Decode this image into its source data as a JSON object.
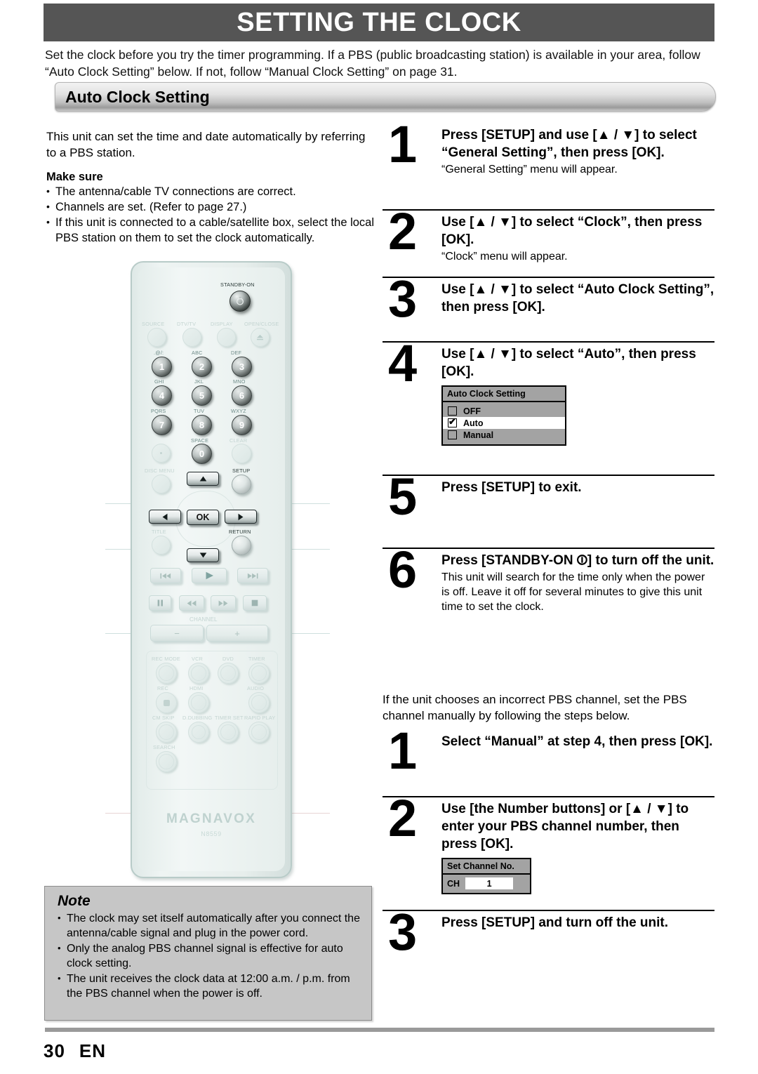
{
  "header": {
    "title": "SETTING THE CLOCK"
  },
  "intro": "Set the clock before you try the timer programming. If a PBS (public broadcasting station) is available in your area, follow “Auto Clock Setting” below. If not, follow “Manual Clock Setting” on page 31.",
  "section": {
    "title": "Auto Clock Setting"
  },
  "left": {
    "paragraph": "This unit can set the time and date automatically by referring to a PBS station.",
    "make_sure_label": "Make sure",
    "make_sure_items": [
      "The antenna/cable TV connections are correct.",
      "Channels are set. (Refer to page 27.)",
      "If this unit is connected to a cable/satellite box, select the local PBS station on them to set the clock automatically."
    ]
  },
  "remote": {
    "brand": "MAGNAVOX",
    "model": "N8559",
    "standby_label": "STANDBY-ON",
    "row_labels": [
      "SOURCE",
      "DTV/TV",
      "DISPLAY",
      "OPEN/CLOSE"
    ],
    "keypad": [
      {
        "sub": ".@/:",
        "num": "1"
      },
      {
        "sub": "ABC",
        "num": "2"
      },
      {
        "sub": "DEF",
        "num": "3"
      },
      {
        "sub": "GHI",
        "num": "4"
      },
      {
        "sub": "JKL",
        "num": "5"
      },
      {
        "sub": "MNO",
        "num": "6"
      },
      {
        "sub": "PQRS",
        "num": "7"
      },
      {
        "sub": "TUV",
        "num": "8"
      },
      {
        "sub": "WXYZ",
        "num": "9"
      }
    ],
    "space_label": "SPACE",
    "zero_label": "0",
    "clear_label": "CLEAR",
    "disc_menu_label": "DISC MENU",
    "setup_label": "SETUP",
    "title_label": "TITLE",
    "return_label": "RETURN",
    "ok_label": "OK",
    "channel_label": "CHANNEL",
    "channel_minus": "−",
    "channel_plus": "+",
    "function_rows": [
      [
        "REC MODE",
        "VCR",
        "DVD",
        "TIMER"
      ],
      [
        "REC",
        "HDMI",
        "",
        "AUDIO"
      ],
      [
        "CM SKIP",
        "D.DUBBING",
        "TIMER SET",
        "RAPID PLAY"
      ],
      [
        "SEARCH"
      ]
    ]
  },
  "note": {
    "title": "Note",
    "items": [
      "The clock may set itself automatically after you connect the antenna/cable signal and plug in the power cord.",
      "Only the analog PBS channel signal is effective for auto clock setting.",
      "The unit receives the clock data at 12:00 a.m. / p.m. from the PBS channel when the power is off."
    ]
  },
  "steps_auto": [
    {
      "num": "1",
      "title": "Press [SETUP] and use [▲ / ▼] to select “General Setting”, then press [OK].",
      "desc": "“General Setting” menu will appear."
    },
    {
      "num": "2",
      "title": "Use [▲ / ▼] to select “Clock”, then press [OK].",
      "desc": "“Clock” menu will appear."
    },
    {
      "num": "3",
      "title": "Use [▲ / ▼] to select “Auto Clock Setting”, then press [OK].",
      "desc": ""
    },
    {
      "num": "4",
      "title": "Use [▲ / ▼] to select “Auto”, then press [OK].",
      "desc": ""
    },
    {
      "num": "5",
      "title": "Press [SETUP] to exit.",
      "desc": ""
    },
    {
      "num": "6",
      "title": "Press [STANDBY-ON ⏼] to turn off the unit.",
      "desc": "This unit will search for the time only when the power is off. Leave it off for several minutes to give this unit time to set the clock."
    }
  ],
  "osd_auto_clock": {
    "title": "Auto Clock Setting",
    "options": [
      {
        "label": "OFF",
        "checked": false,
        "selected": false
      },
      {
        "label": "Auto",
        "checked": true,
        "selected": true
      },
      {
        "label": "Manual",
        "checked": false,
        "selected": false
      }
    ],
    "check_glyph": "✔"
  },
  "manual_intro": "If the unit chooses an incorrect PBS channel, set the PBS channel manually by following the steps below.",
  "steps_manual": [
    {
      "num": "1",
      "title": "Select “Manual” at step 4, then press [OK]."
    },
    {
      "num": "2",
      "title": "Use [the Number buttons] or [▲ / ▼] to enter your PBS channel number, then press [OK]."
    },
    {
      "num": "3",
      "title": "Press [SETUP] and turn off the unit."
    }
  ],
  "osd_set_channel": {
    "title": "Set Channel No.",
    "ch_label": "CH",
    "ch_value": "1"
  },
  "footer": {
    "page": "30",
    "lang": "EN"
  },
  "colors": {
    "title_bar": "#555555",
    "osd_gray": "#a3a3a3",
    "note_gray": "#c6c6c6",
    "remote_body": "#e7eeec"
  }
}
